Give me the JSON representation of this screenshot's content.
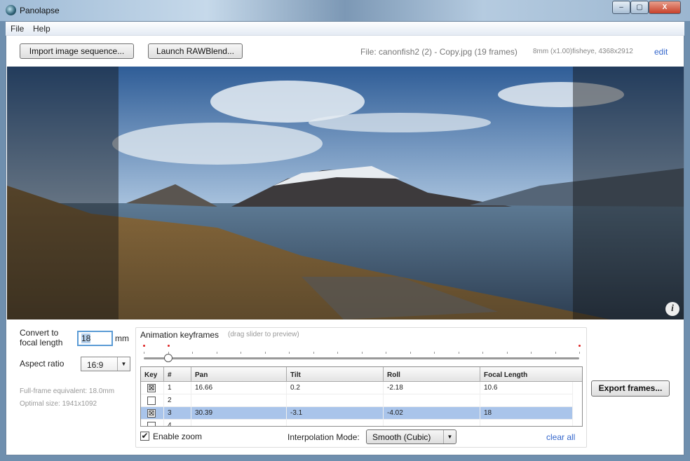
{
  "window": {
    "title": "Panolapse",
    "minimize": "–",
    "maximize": "▢",
    "close": "X"
  },
  "menu": [
    "File",
    "Help"
  ],
  "toolbar": {
    "import_label": "Import image sequence...",
    "rawblend_label": "Launch RAWBlend...",
    "file_info": "File: canonfish2 (2) - Copy.jpg (19 frames)",
    "lens_info": "8mm (x1.00)fisheye, 4368x2912",
    "edit_label": "edit"
  },
  "preview": {
    "info_icon": "info-icon"
  },
  "settings": {
    "focal_label_1": "Convert to",
    "focal_label_2": "focal length",
    "focal_value": "18",
    "focal_unit": "mm",
    "aspect_label": "Aspect ratio",
    "aspect_value": "16:9",
    "full_frame": "Full-frame equivalent: 18.0mm",
    "optimal": "Optimal size: 1941x1092"
  },
  "keyframes": {
    "title": "Animation keyframes",
    "hint": "(drag slider to preview)",
    "frame_count": 19,
    "slider_position_frame": 2,
    "keyframe_frames": [
      1,
      2,
      19
    ],
    "columns": [
      "Key",
      "#",
      "Pan",
      "Tilt",
      "Roll",
      "Focal Length"
    ],
    "rows": [
      {
        "key": true,
        "n": "1",
        "pan": "16.66",
        "tilt": "0.2",
        "roll": "-2.18",
        "focal": "10.6",
        "selected": false
      },
      {
        "key": false,
        "n": "2",
        "pan": "",
        "tilt": "",
        "roll": "",
        "focal": "",
        "selected": false
      },
      {
        "key": true,
        "n": "3",
        "pan": "30.39",
        "tilt": "-3.1",
        "roll": "-4.02",
        "focal": "18",
        "selected": true
      },
      {
        "key": false,
        "n": "4",
        "pan": "",
        "tilt": "",
        "roll": "",
        "focal": "",
        "selected": false
      }
    ],
    "enable_zoom_label": "Enable zoom",
    "enable_zoom": true,
    "interp_label": "Interpolation Mode:",
    "interp_value": "Smooth (Cubic)",
    "clear_all": "clear all"
  },
  "export_label": "Export frames...",
  "colors": {
    "selection": "#a9c4ea",
    "link": "#3366cc",
    "keyframe": "#dd2222"
  }
}
